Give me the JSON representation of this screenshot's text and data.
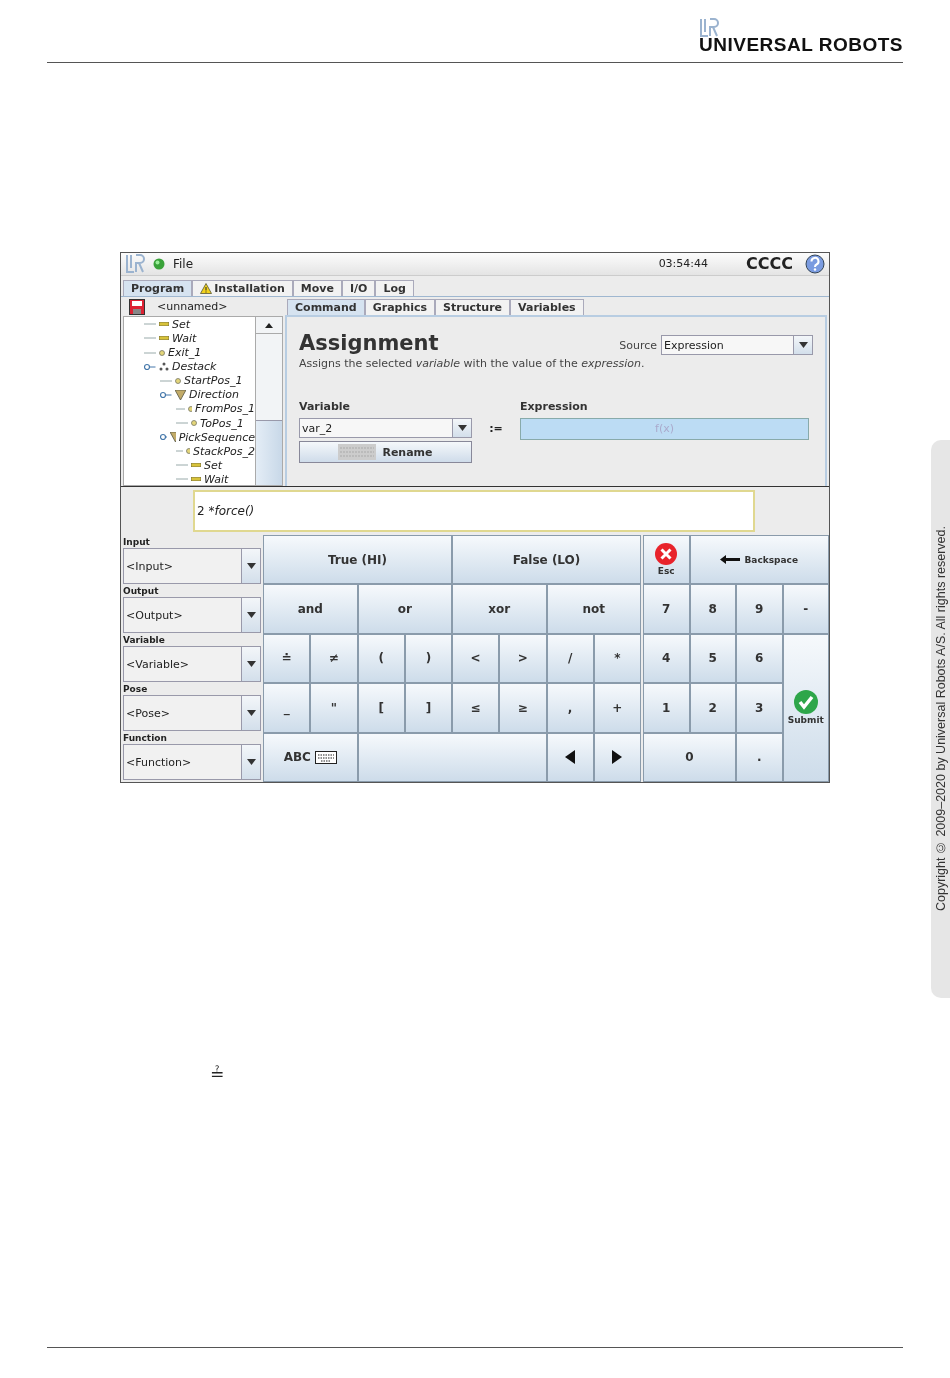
{
  "header": {
    "brand": "UNIVERSAL ROBOTS"
  },
  "screen": {
    "top_bar": {
      "menu": "File",
      "time": "03:54:44",
      "robot_name": "CCCC"
    },
    "tabs": [
      {
        "label": "Program",
        "selected": true,
        "kind": "plain"
      },
      {
        "label": "Installation",
        "selected": false,
        "kind": "warning"
      },
      {
        "label": "Move",
        "selected": false,
        "kind": "plain"
      },
      {
        "label": "I/O",
        "selected": false,
        "kind": "plain"
      },
      {
        "label": "Log",
        "selected": false,
        "kind": "plain"
      }
    ],
    "program_name": "<unnamed>",
    "tree": [
      {
        "label": "Set",
        "kind": "set"
      },
      {
        "label": "Wait",
        "kind": "wait"
      },
      {
        "label": "Exit_1",
        "kind": "waypoint"
      },
      {
        "label": "Destack",
        "kind": "pallet",
        "children": [
          {
            "label": "StartPos_1",
            "kind": "waypoint"
          },
          {
            "label": "Direction",
            "kind": "direction",
            "children": [
              {
                "label": "FromPos_1",
                "kind": "waypoint"
              },
              {
                "label": "ToPos_1",
                "kind": "waypoint"
              }
            ]
          },
          {
            "label": "PickSequence",
            "kind": "direction",
            "children": [
              {
                "label": "StackPos_2",
                "kind": "waypoint"
              },
              {
                "label": "Set",
                "kind": "set"
              },
              {
                "label": "Wait",
                "kind": "wait"
              }
            ]
          }
        ]
      }
    ],
    "sub_tabs": [
      {
        "label": "Command",
        "selected": true
      },
      {
        "label": "Graphics",
        "selected": false
      },
      {
        "label": "Structure",
        "selected": false
      },
      {
        "label": "Variables",
        "selected": false
      }
    ],
    "command": {
      "title": "Assignment",
      "description": "Assigns the selected *variable* with the value of the *expression*.",
      "source_label": "Source",
      "source_value": "Expression",
      "variable_label": "Variable",
      "variable_value": "var_2",
      "assign_sign": ":=",
      "expression_label": "Expression",
      "expression_placeholder": "f(x)",
      "rename_button": "Rename"
    },
    "expression_input": {
      "operand": "2 *",
      "function": "force()"
    },
    "selectors": [
      {
        "label": "Input",
        "value": "<Input>"
      },
      {
        "label": "Output",
        "value": "<Output>"
      },
      {
        "label": "Variable",
        "value": "<Variable>"
      },
      {
        "label": "Pose",
        "value": "<Pose>"
      },
      {
        "label": "Function",
        "value": "<Function>"
      }
    ],
    "operator_keys": [
      {
        "label": "True (HI)"
      },
      {
        "label": "False (LO)"
      },
      {
        "label": "and"
      },
      {
        "label": "or"
      },
      {
        "label": "xor"
      },
      {
        "label": "not"
      },
      {
        "label": "≐"
      },
      {
        "label": "≠"
      },
      {
        "label": "("
      },
      {
        "label": ")"
      },
      {
        "label": "<"
      },
      {
        "label": ">"
      },
      {
        "label": "/"
      },
      {
        "label": "*"
      },
      {
        "label": "_"
      },
      {
        "label": "\""
      },
      {
        "label": "["
      },
      {
        "label": "]"
      },
      {
        "label": "≤"
      },
      {
        "label": "≥"
      },
      {
        "label": ","
      },
      {
        "label": "+"
      },
      {
        "label": "ABC",
        "kind": "abc"
      },
      {
        "kind": "blank"
      },
      {
        "kind": "left"
      },
      {
        "kind": "right"
      }
    ],
    "number_keys": [
      {
        "label": "Esc",
        "kind": "esc"
      },
      {
        "label": "Backspace",
        "kind": "backspace"
      },
      {
        "label": "7"
      },
      {
        "label": "8"
      },
      {
        "label": "9"
      },
      {
        "label": "-"
      },
      {
        "label": "4"
      },
      {
        "label": "5"
      },
      {
        "label": "6"
      },
      {
        "label": "Submit",
        "kind": "submit"
      },
      {
        "label": "1"
      },
      {
        "label": "2"
      },
      {
        "label": "3"
      },
      {
        "label": "0"
      },
      {
        "label": "."
      }
    ]
  },
  "symbol": "≟",
  "copyright": "Copyright © 2009–2020 by Universal Robots A/S. All rights reserved."
}
